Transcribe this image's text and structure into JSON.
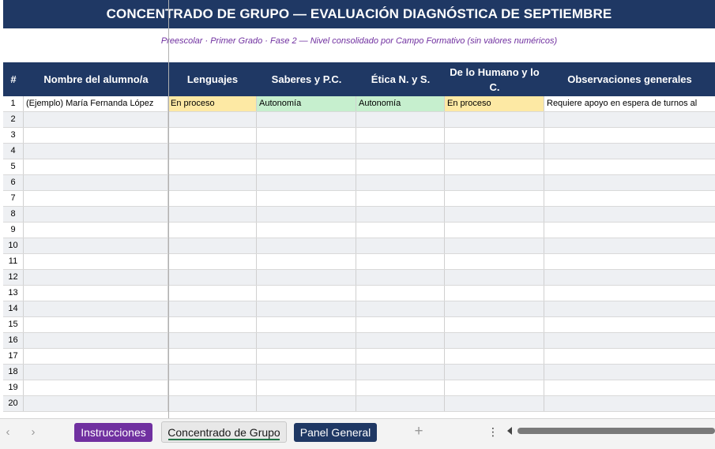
{
  "title": "CONCENTRADO DE GRUPO — EVALUACIÓN DIAGNÓSTICA DE SEPTIEMBRE",
  "subtitle": "Preescolar · Primer Grado · Fase 2  —  Nivel consolidado por Campo Formativo (sin valores numéricos)",
  "headers": [
    "#",
    "Nombre del alumno/a",
    "Lenguajes",
    "Saberes y P.C.",
    "Ética N. y S.",
    "De lo Humano y lo C.",
    "Observaciones generales"
  ],
  "example_row": {
    "num": "1",
    "name": "(Ejemplo) María Fernanda López",
    "lenguajes": "En proceso",
    "saberes": "Autonomía",
    "etica": "Autonomía",
    "humano": "En proceso",
    "observaciones": "Requiere apoyo en espera de turnos al"
  },
  "row_numbers": [
    "2",
    "3",
    "4",
    "5",
    "6",
    "7",
    "8",
    "9",
    "10",
    "11",
    "12",
    "13",
    "14",
    "15",
    "16",
    "17",
    "18",
    "19",
    "20"
  ],
  "tabs": {
    "instrucciones": "Instrucciones",
    "concentrado": "Concentrado de Grupo",
    "panel": "Panel General"
  },
  "icons": {
    "prev": "chevron-left-icon",
    "next": "chevron-right-icon",
    "add": "plus-icon",
    "more": "more-vertical-icon"
  },
  "colors": {
    "header_bg": "#1f3864",
    "subtitle_text": "#7030a0",
    "en_proceso": "#fde9a4",
    "autonomia": "#c6efce",
    "instrucciones_tab": "#7030a0",
    "panel_tab": "#1f3864"
  }
}
